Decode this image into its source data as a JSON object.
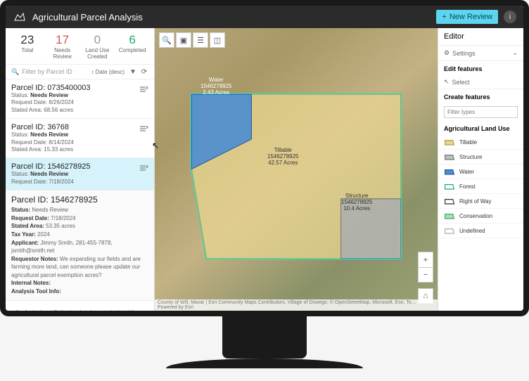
{
  "topbar": {
    "title": "Agricultural Parcel Analysis",
    "new_review": "New Review"
  },
  "stats": {
    "total": {
      "num": "23",
      "label": "Total"
    },
    "needs": {
      "num": "17",
      "label": "Needs Review"
    },
    "landuse": {
      "num": "0",
      "label": "Land Use Created"
    },
    "completed": {
      "num": "6",
      "label": "Completed"
    }
  },
  "filters": {
    "placeholder": "Filter by Parcel ID",
    "sort": "Date (desc)"
  },
  "parcels": [
    {
      "id": "Parcel ID: 0735400003",
      "status_label": "Status:",
      "status": "Needs Review",
      "request_label": "Request Date:",
      "request": "8/26/2024",
      "area_label": "Stated Area:",
      "area": "68.56 acres"
    },
    {
      "id": "Parcel ID: 36768",
      "status_label": "Status:",
      "status": "Needs Review",
      "request_label": "Request Date:",
      "request": "8/14/2024",
      "area_label": "Stated Area:",
      "area": "15.33 acres"
    },
    {
      "id": "Parcel ID: 1546278925",
      "status_label": "Status:",
      "status": "Needs Review",
      "request_label": "Request Date:",
      "request": "7/18/2024"
    }
  ],
  "detail": {
    "id": "Parcel ID: 1546278925",
    "status_label": "Status:",
    "status": "Needs Review",
    "request_label": "Request Date:",
    "request": "7/18/2024",
    "area_label": "Stated Area:",
    "area": "53.35 acres",
    "taxyear_label": "Tax Year:",
    "taxyear": "2024",
    "applicant_label": "Applicant:",
    "applicant": "Jimmy Smith, 281-455-7878, jsmith@smith.net",
    "notes_label": "Requestor Notes:",
    "notes": "We expanding our fields and are farming more land, can someone please update our agricultural parcel exemption acres?",
    "internal_label": "Internal Notes:",
    "analysis_label": "Analysis Tool Info:",
    "no_data": "No Agricultural Soils data has been calculated for this parcel"
  },
  "map": {
    "labels": {
      "water_name": "Water",
      "water_id": "1546278925",
      "water_area": "2.43 Acres",
      "tillable_name": "Tillable",
      "tillable_id": "1546278925",
      "tillable_area": "42.57 Acres",
      "structure_name": "Structure",
      "structure_id": "1546278925",
      "structure_area": "10.4 Acres"
    },
    "attrib": "County of Will, Maxar | Esri Community Maps Contributors, Village of Oswego, © OpenStreetMap, Microsoft, Esri, To…    Powered by Esri"
  },
  "editor": {
    "title": "Editor",
    "settings": "Settings",
    "edit_features": "Edit features",
    "select": "Select",
    "create_features": "Create features",
    "filter_placeholder": "Filter types",
    "legend_title": "Agricultural Land Use",
    "legend": [
      {
        "label": "Tillable",
        "fill": "#e8d690",
        "stroke": "#b89e3a"
      },
      {
        "label": "Structure",
        "fill": "#c0c0c0",
        "stroke": "#777"
      },
      {
        "label": "Water",
        "fill": "#4a90d9",
        "stroke": "#2c5a9e"
      },
      {
        "label": "Forest",
        "fill": "#ffffff",
        "stroke": "#1fa968"
      },
      {
        "label": "Right of Way",
        "fill": "#ffffff",
        "stroke": "#333"
      },
      {
        "label": "Conservation",
        "fill": "#a8e0b8",
        "stroke": "#3ba968"
      },
      {
        "label": "Undefined",
        "fill": "#ffffff",
        "stroke": "#aaa"
      }
    ]
  }
}
